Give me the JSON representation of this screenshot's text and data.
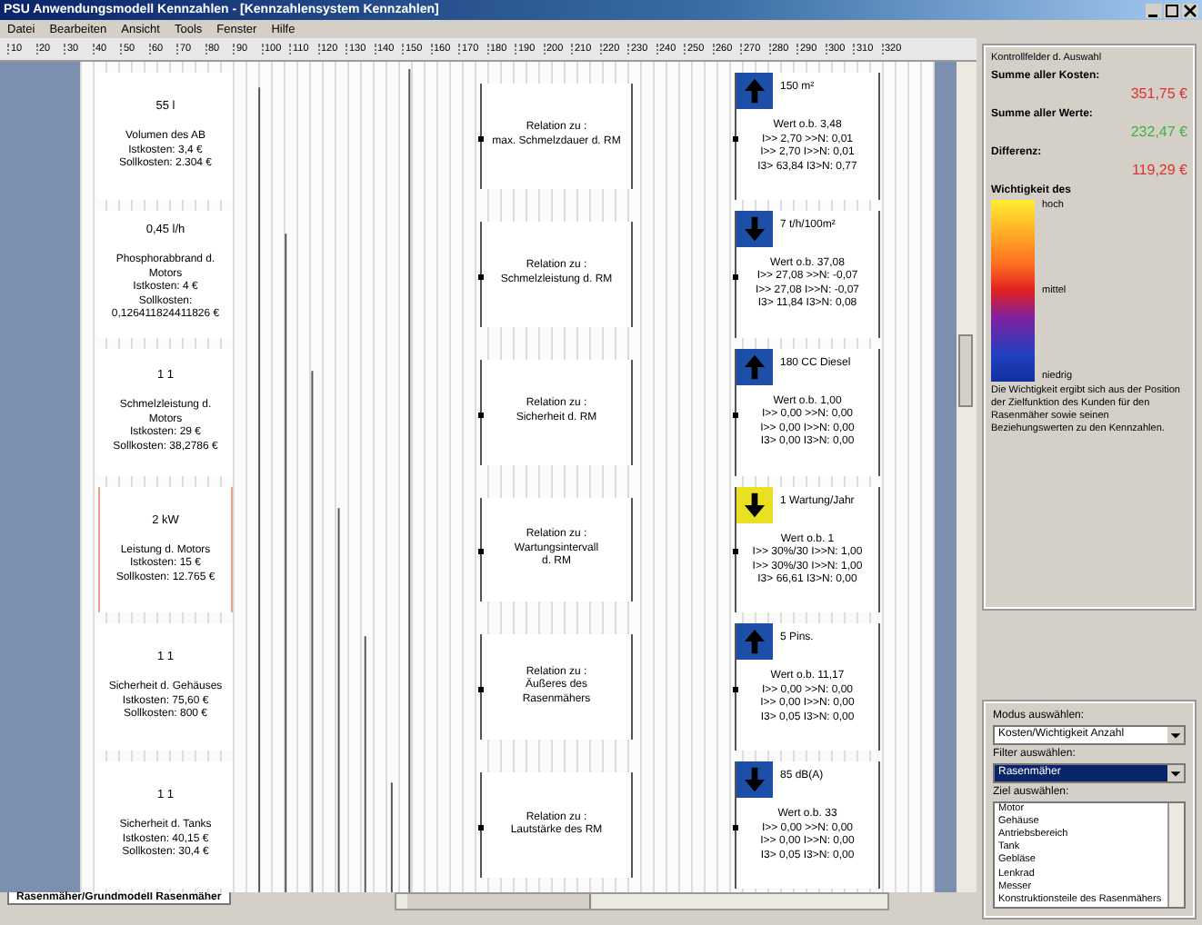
{
  "window": {
    "title": "PSU Anwendungsmodell Kennzahlen - [Kennzahlensystem Kennzahlen]"
  },
  "menu": [
    "Datei",
    "Bearbeiten",
    "Ansicht",
    "Tools",
    "Fenster",
    "Hilfe"
  ],
  "ruler": [
    "10",
    "20",
    "30",
    "40",
    "50",
    "60",
    "70",
    "80",
    "90",
    "100",
    "110",
    "120",
    "130",
    "140",
    "150",
    "160",
    "170",
    "180",
    "190",
    "200",
    "210",
    "220",
    "230",
    "240",
    "250",
    "260",
    "270",
    "280",
    "290",
    "300",
    "310",
    "320"
  ],
  "rows": [
    {
      "value": "55 l",
      "lines": [
        "Volumen des AB",
        "Istkosten: 3,4 €",
        "Sollkosten: 2.304 €"
      ],
      "highlighted": false,
      "relation": [
        "Relation zu :",
        "max. Schmelzdauer d. RM"
      ],
      "increase": true,
      "color": "#1e4fa8",
      "target": "150 m²",
      "stats": [
        "Wert o.b. 3,48",
        "I>> 2,70 >>N: 0,01",
        "I>> 2,70 I>>N: 0,01",
        "I3> 63,84 I3>N: 0,77"
      ]
    },
    {
      "value": "0,45 l/h",
      "lines": [
        "Phosphorabbrand d.",
        "Motors",
        "Istkosten: 4 €",
        "Sollkosten:",
        "0,126411824411826 €"
      ],
      "highlighted": false,
      "relation": [
        "Relation zu :",
        "Schmelzleistung d. RM"
      ],
      "increase": false,
      "color": "#1e4fa8",
      "target": "7 t/h/100m²",
      "stats": [
        "Wert o.b. 37,08",
        "I>> 27,08 >>N: -0,07",
        "I>> 27,08 I>>N: -0,07",
        "I3> 11,84 I3>N: 0,08"
      ]
    },
    {
      "value": "1 1",
      "lines": [
        "Schmelzleistung d.",
        "Motors",
        "Istkosten: 29 €",
        "Sollkosten: 38,2786 €"
      ],
      "highlighted": false,
      "relation": [
        "Relation zu :",
        "Sicherheit d. RM"
      ],
      "increase": true,
      "color": "#1e4fa8",
      "target": "180 CC Diesel",
      "stats": [
        "Wert o.b. 1,00",
        "I>> 0,00 >>N: 0,00",
        "I>> 0,00 I>>N: 0,00",
        "I3> 0,00 I3>N: 0,00"
      ]
    },
    {
      "value": "2 kW",
      "lines": [
        "Leistung d. Motors",
        "Istkosten: 15 €",
        "Sollkosten: 12.765 €"
      ],
      "highlighted": true,
      "relation": [
        "Relation zu :",
        "Wartungsintervall",
        "d. RM"
      ],
      "increase": false,
      "color": "#e8e020",
      "target": "1 Wartung/Jahr",
      "stats": [
        "Wert o.b. 1",
        "I>> 30%/30 I>>N: 1,00",
        "I>> 30%/30 I>>N: 1,00",
        "I3> 66,61 I3>N: 0,00"
      ]
    },
    {
      "value": "1 1",
      "lines": [
        "Sicherheit d. Gehäuses",
        "Istkosten: 75,60 €",
        "Sollkosten: 800 €"
      ],
      "highlighted": false,
      "relation": [
        "Relation zu :",
        "Äußeres des",
        "Rasenmähers"
      ],
      "increase": true,
      "color": "#1e4fa8",
      "target": "5 Pins.",
      "stats": [
        "Wert o.b. 11,17",
        "I>> 0,00 >>N: 0,00",
        "I>> 0,00 I>>N: 0,00",
        "I3> 0,05 I3>N: 0,00"
      ]
    },
    {
      "value": "1 1",
      "lines": [
        "Sicherheit d. Tanks",
        "Istkosten: 40,15 €",
        "Sollkosten: 30,4 €"
      ],
      "highlighted": false,
      "relation": [
        "Relation zu :",
        "Lautstärke des RM"
      ],
      "increase": false,
      "color": "#1e4fa8",
      "target": "85 dB(A)",
      "stats": [
        "Wert o.b. 33",
        "I>> 0,00 >>N: 0,00",
        "I>> 0,00 I>>N: 0,00",
        "I3> 0,05 I3>N: 0,00"
      ]
    }
  ],
  "sheet_tab": "Rasenmäher/Grundmodell Rasenmäher",
  "panel": {
    "title": "Kontrollfelder d. Auswahl",
    "sums": [
      {
        "label": "Summe aller Kosten:",
        "value": "351,75 €",
        "color": "#e03030"
      },
      {
        "label": "Summe aller Werte:",
        "value": "232,47 €",
        "color": "#40b040"
      },
      {
        "label": "Differenz:",
        "value": "119,29 €",
        "color": "#e03030"
      }
    ],
    "legend_title": "Wichtigkeit des",
    "legend": [
      "hoch",
      "mittel",
      "niedrig"
    ],
    "note": "Die Wichtigkeit ergibt sich aus der Position der Zielfunktion des Kunden für den Rasenmäher sowie seinen Beziehungswerten zu den Kennzahlen."
  },
  "controls": [
    {
      "label": "Modus auswählen:",
      "kind": "dropdown",
      "value": "Kosten/Wichtigkeit Anzahl",
      "focused": false
    },
    {
      "label": "Filter auswählen:",
      "kind": "dropdown",
      "value": "Rasenmäher",
      "focused": true
    },
    {
      "label": "Ziel auswählen:",
      "kind": "list",
      "items": [
        "Motor",
        "Gehäuse",
        "Antriebsbereich",
        "Tank",
        "Gebläse",
        "Lenkrad",
        "Messer",
        "Konstruktionsteile des Rasenmähers"
      ]
    }
  ]
}
